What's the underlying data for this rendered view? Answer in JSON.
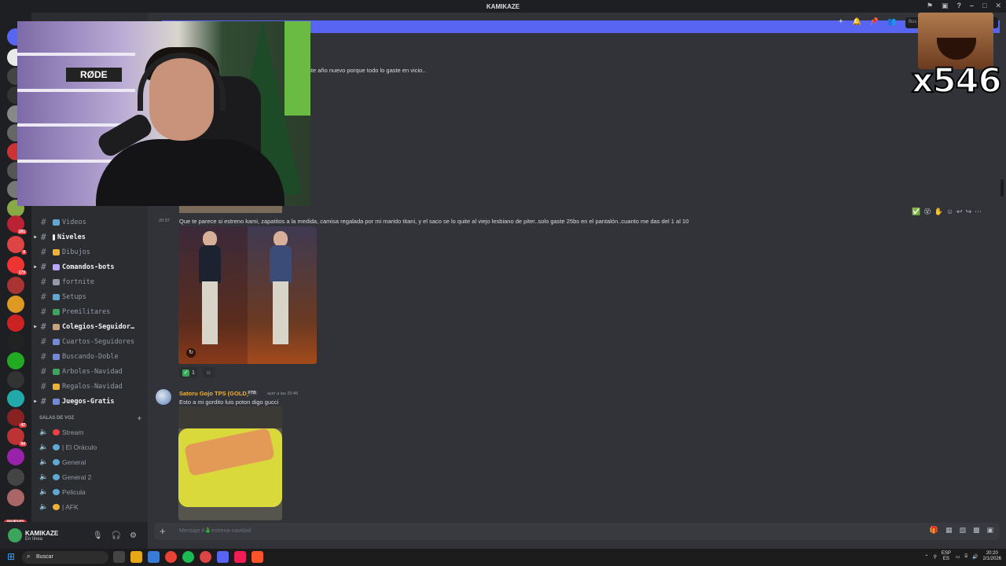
{
  "window": {
    "title": "KAMIKAZE"
  },
  "colors": {
    "blurple": "#5865f2",
    "online": "#3ba55c",
    "username_gold": "#f0b232",
    "badge_red": "#f23f43"
  },
  "servers": {
    "badges": [
      "281",
      "8",
      "179",
      "47",
      "94"
    ],
    "new_label": "NUEVO"
  },
  "channels": {
    "text": [
      {
        "label": "Videos",
        "bold": false,
        "expandable": false,
        "icon": "camera-icon",
        "color": "#5fa8d3"
      },
      {
        "label": "Niveles",
        "bold": true,
        "expandable": true,
        "icon": "bar-icon",
        "color": "#f2f3f5"
      },
      {
        "label": "Dibujos",
        "bold": false,
        "expandable": false,
        "icon": "hand-icon",
        "color": "#f0b232"
      },
      {
        "label": "Comandos-bots",
        "bold": true,
        "expandable": true,
        "icon": "robot-icon",
        "color": "#b9a7ff"
      },
      {
        "label": "fortnite",
        "bold": false,
        "expandable": false,
        "icon": "pickaxe-icon",
        "color": "#949ba4"
      },
      {
        "label": "Setups",
        "bold": false,
        "expandable": false,
        "icon": "monitor-icon",
        "color": "#5fa8d3"
      },
      {
        "label": "Premilitares",
        "bold": false,
        "expandable": false,
        "icon": "tree-icon",
        "color": "#3ba55c"
      },
      {
        "label": "Colegios-Seguidor…",
        "bold": true,
        "expandable": true,
        "icon": "school-icon",
        "color": "#c7a27a"
      },
      {
        "label": "Cuartos-Seguidores",
        "bold": false,
        "expandable": false,
        "icon": "bed-icon",
        "color": "#7289da"
      },
      {
        "label": "Buscando-Doble",
        "bold": false,
        "expandable": false,
        "icon": "people-icon",
        "color": "#7289da"
      },
      {
        "label": "Arboles-Navidad",
        "bold": false,
        "expandable": false,
        "icon": "xmas-tree-icon",
        "color": "#3ba55c"
      },
      {
        "label": "Regalos-Navidad",
        "bold": false,
        "expandable": false,
        "icon": "gift-icon",
        "color": "#f0b232"
      },
      {
        "label": "Juegos-Gratis",
        "bold": true,
        "expandable": true,
        "icon": "gamepad-icon",
        "color": "#7289da"
      }
    ],
    "voice_category": "SALAS DE VOZ",
    "voice": [
      {
        "label": "Stream",
        "icon": "red-circle-icon",
        "color": "#f23f43"
      },
      {
        "label": "| El Oráculo",
        "icon": "globe-icon",
        "color": "#5fa8d3"
      },
      {
        "label": "General",
        "icon": "globe-icon",
        "color": "#5fa8d3"
      },
      {
        "label": "General 2",
        "icon": "globe-icon",
        "color": "#5fa8d3"
      },
      {
        "label": "Pelicula",
        "icon": "globe-icon",
        "color": "#5fa8d3"
      },
      {
        "label": "| AFK",
        "icon": "sleep-icon",
        "color": "#f0b232"
      }
    ]
  },
  "user_panel": {
    "name": "KAMIKAZE",
    "status": "En línea"
  },
  "header": {
    "search_placeholder": "Bus"
  },
  "messages": {
    "top_text": "este año nuevo porque todo lo gaste en vicio..",
    "msg1": {
      "time": "20:37",
      "text": "Que te parece si estreno kami, zapatitos a la medida, camisa regalada por mi marido titani, y el saco se lo quite al viejo lesbiano de piter..solo gaste 25bs en el pantalón..cuanto me das del 1 al 10",
      "reactions": [
        {
          "count": "1"
        }
      ]
    },
    "msg2": {
      "author": "Satoru Gojo TPS (GOLD)",
      "tag": "FTB",
      "time": "ayer a las 20:45",
      "text": "Esto a mi gordito luis poton digo gucci"
    }
  },
  "composer": {
    "placeholder": "Mensaje #🎄estrena-navidad"
  },
  "overlay": {
    "combo": "x546"
  },
  "taskbar": {
    "search": "Buscar",
    "lang_top": "ESP",
    "lang_bottom": "ES",
    "time": "20:20",
    "date": "2/1/2026"
  }
}
